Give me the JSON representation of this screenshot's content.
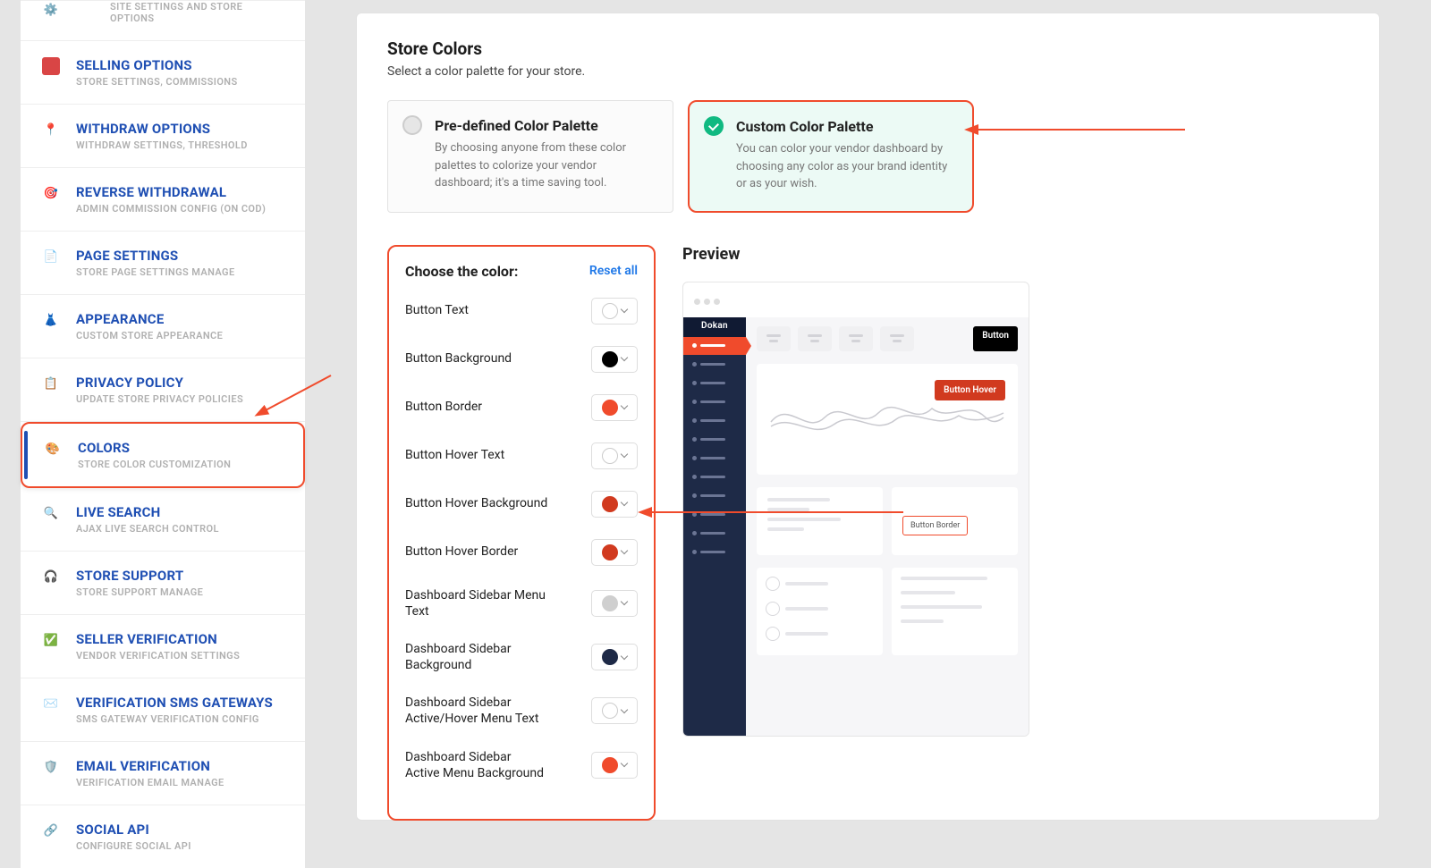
{
  "sidebar": {
    "items": [
      {
        "title": "",
        "sub": "SITE SETTINGS AND STORE OPTIONS",
        "partial": true,
        "iconBg": "transparent",
        "iconEmoji": ""
      },
      {
        "title": "SELLING OPTIONS",
        "sub": "STORE SETTINGS, COMMISSIONS",
        "iconBg": "#d94545",
        "iconEmoji": ""
      },
      {
        "title": "WITHDRAW OPTIONS",
        "sub": "WITHDRAW SETTINGS, THRESHOLD",
        "iconBg": "transparent",
        "iconEmoji": "📍"
      },
      {
        "title": "REVERSE WITHDRAWAL",
        "sub": "ADMIN COMMISSION CONFIG (ON COD)",
        "iconBg": "transparent",
        "iconEmoji": "🎯"
      },
      {
        "title": "PAGE SETTINGS",
        "sub": "STORE PAGE SETTINGS MANAGE",
        "iconBg": "transparent",
        "iconEmoji": "📄"
      },
      {
        "title": "APPEARANCE",
        "sub": "CUSTOM STORE APPEARANCE",
        "iconBg": "transparent",
        "iconEmoji": "👗"
      },
      {
        "title": "PRIVACY POLICY",
        "sub": "UPDATE STORE PRIVACY POLICIES",
        "iconBg": "transparent",
        "iconEmoji": "📋"
      },
      {
        "title": "COLORS",
        "sub": "STORE COLOR CUSTOMIZATION",
        "active": true,
        "iconBg": "transparent",
        "iconEmoji": "🎨"
      },
      {
        "title": "LIVE SEARCH",
        "sub": "AJAX LIVE SEARCH CONTROL",
        "iconBg": "transparent",
        "iconEmoji": "🔍"
      },
      {
        "title": "STORE SUPPORT",
        "sub": "STORE SUPPORT MANAGE",
        "iconBg": "transparent",
        "iconEmoji": "🎧"
      },
      {
        "title": "SELLER VERIFICATION",
        "sub": "VENDOR VERIFICATION SETTINGS",
        "iconBg": "transparent",
        "iconEmoji": "✅"
      },
      {
        "title": "VERIFICATION SMS GATEWAYS",
        "sub": "SMS GATEWAY VERIFICATION CONFIG",
        "iconBg": "transparent",
        "iconEmoji": "✉️"
      },
      {
        "title": "EMAIL VERIFICATION",
        "sub": "VERIFICATION EMAIL MANAGE",
        "iconBg": "transparent",
        "iconEmoji": "🛡️"
      },
      {
        "title": "SOCIAL API",
        "sub": "CONFIGURE SOCIAL API",
        "iconBg": "transparent",
        "iconEmoji": "🔗"
      }
    ]
  },
  "main": {
    "heading": "Store Colors",
    "desc": "Select a color palette for your store.",
    "palettes": {
      "predefined": {
        "title": "Pre-defined Color Palette",
        "desc": "By choosing anyone from these color palettes to colorize your vendor dashboard; it's a time saving tool."
      },
      "custom": {
        "title": "Custom Color Palette",
        "desc": "You can color your vendor dashboard by choosing any color as your brand identity or as your wish."
      }
    },
    "choose": {
      "title": "Choose the color:",
      "reset": "Reset all",
      "rows": [
        {
          "label": "Button Text",
          "color": "#ffffff"
        },
        {
          "label": "Button Background",
          "color": "#000000"
        },
        {
          "label": "Button Border",
          "color": "#f04b2c"
        },
        {
          "label": "Button Hover Text",
          "color": "#ffffff"
        },
        {
          "label": "Button Hover Background",
          "color": "#d13a1f"
        },
        {
          "label": "Button Hover Border",
          "color": "#d13a1f"
        },
        {
          "label": "Dashboard Sidebar Menu Text",
          "color": "#cfcfcf"
        },
        {
          "label": "Dashboard Sidebar Background",
          "color": "#1e2a47"
        },
        {
          "label": "Dashboard Sidebar Active/Hover Menu Text",
          "color": "#ffffff"
        },
        {
          "label": "Dashboard Sidebar Active Menu Background",
          "color": "#f04b2c"
        }
      ]
    },
    "preview": {
      "title": "Preview",
      "brand": "Dokan",
      "button": "Button",
      "buttonHover": "Button Hover",
      "buttonBorder": "Button Border"
    }
  }
}
